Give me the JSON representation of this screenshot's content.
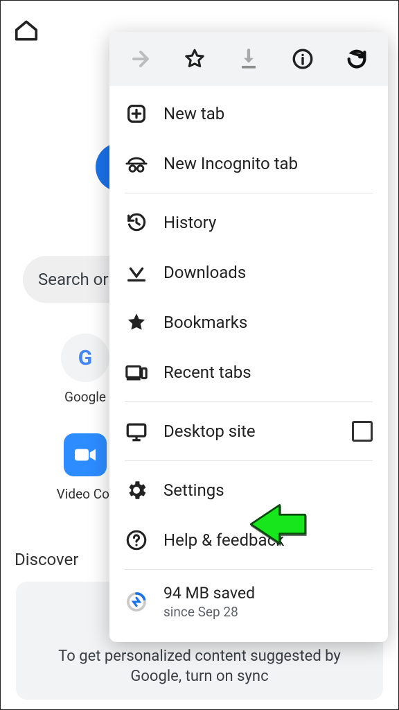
{
  "topbar": {
    "home": "Home"
  },
  "search_placeholder": "Search or",
  "shortcuts": {
    "google": {
      "label": "Google"
    },
    "zoom": {
      "label": "Video Cor"
    }
  },
  "discover_heading": "Discover",
  "discover_card_text": "To get personalized content suggested by Google, turn on sync",
  "menu": {
    "new_tab": "New tab",
    "incognito": "New Incognito tab",
    "history": "History",
    "downloads": "Downloads",
    "bookmarks": "Bookmarks",
    "recent_tabs": "Recent tabs",
    "desktop_site": "Desktop site",
    "settings": "Settings",
    "help": "Help & feedback",
    "data_saved_line1": "94 MB saved",
    "data_saved_line2": "since Sep 28"
  }
}
